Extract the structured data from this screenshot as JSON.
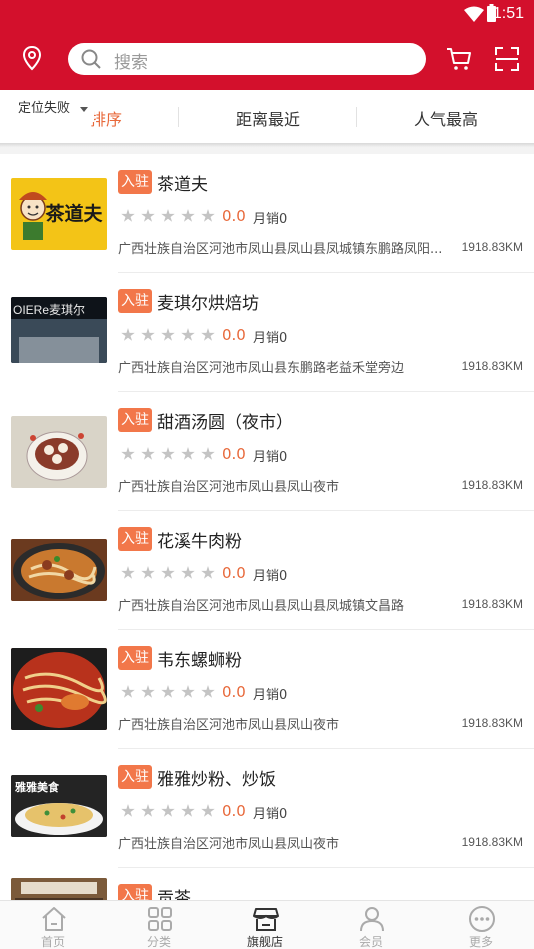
{
  "status_bar": {
    "time": "1:51"
  },
  "header": {
    "search_placeholder": "搜索"
  },
  "filters": {
    "location_label": "定位失败",
    "sort_label": "排序",
    "nearest_label": "距离最近",
    "popular_label": "人气最高"
  },
  "shops": [
    {
      "badge": "入驻",
      "name": "茶道夫",
      "rating": "0.0",
      "sales": "月销0",
      "address": "广西壮族自治区河池市凤山县凤山县凤城镇东鹏路凤阳...",
      "distance": "1918.83KM",
      "thumb_sign": "茶道夫",
      "thumb_color": "#f3c417"
    },
    {
      "badge": "入驻",
      "name": "麦琪尔烘焙坊",
      "rating": "0.0",
      "sales": "月销0",
      "address": "广西壮族自治区河池市凤山县东鹏路老益禾堂旁边",
      "distance": "1918.83KM",
      "thumb_sign": "OIERe麦琪尔",
      "thumb_color": "#1e2630"
    },
    {
      "badge": "入驻",
      "name": "甜酒汤圆（夜市）",
      "rating": "0.0",
      "sales": "月销0",
      "address": "广西壮族自治区河池市凤山县凤山夜市",
      "distance": "1918.83KM",
      "thumb_sign": "",
      "thumb_color": "#d9d4c8"
    },
    {
      "badge": "入驻",
      "name": "花溪牛肉粉",
      "rating": "0.0",
      "sales": "月销0",
      "address": "广西壮族自治区河池市凤山县凤山县凤城镇文昌路",
      "distance": "1918.83KM",
      "thumb_sign": "",
      "thumb_color": "#b5602a"
    },
    {
      "badge": "入驻",
      "name": "韦东螺蛳粉",
      "rating": "0.0",
      "sales": "月销0",
      "address": "广西壮族自治区河池市凤山县凤山夜市",
      "distance": "1918.83KM",
      "thumb_sign": "",
      "thumb_color": "#a9291a"
    },
    {
      "badge": "入驻",
      "name": "雅雅炒粉、炒饭",
      "rating": "0.0",
      "sales": "月销0",
      "address": "广西壮族自治区河池市凤山县凤山夜市",
      "distance": "1918.83KM",
      "thumb_sign": "雅雅美食",
      "thumb_color": "#2a2a2a"
    },
    {
      "badge": "入驻",
      "name": "贡茶",
      "rating": "",
      "sales": "",
      "address": "",
      "distance": "",
      "thumb_sign": "",
      "thumb_color": "#8a6a4a"
    }
  ],
  "tabbar": {
    "home": "首页",
    "category": "分类",
    "flagship": "旗舰店",
    "member": "会员",
    "more": "更多"
  },
  "colors": {
    "brand_red": "#d3102c",
    "accent_orange": "#e8693b",
    "badge_orange": "#f2774a"
  },
  "icons": [
    "location-icon",
    "search-icon",
    "cart-icon",
    "scan-icon",
    "home-icon",
    "category-icon",
    "store-icon",
    "member-icon",
    "more-icon"
  ]
}
